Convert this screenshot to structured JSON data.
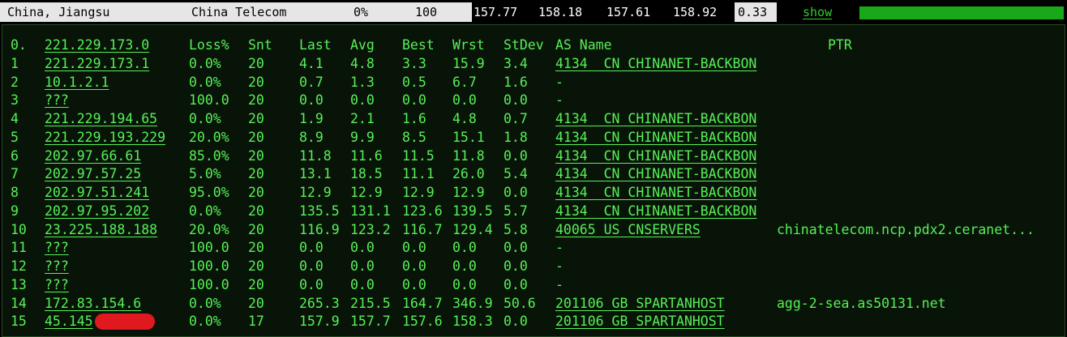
{
  "header": {
    "location": "China, Jiangsu",
    "isp": "China Telecom",
    "loss": "0%",
    "count": "100",
    "last": "157.77",
    "avg": "158.18",
    "best": "157.61",
    "worst": "158.92",
    "stdev": "0.33",
    "show_label": "show",
    "progress_fraction": 1.0,
    "progress_color": "#19a819"
  },
  "columns": {
    "idx": "0.",
    "host": "221.229.173.0",
    "loss": "Loss%",
    "snt": "Snt",
    "last": "Last",
    "avg": "Avg",
    "best": "Best",
    "wrst": "Wrst",
    "stdev": "StDev",
    "as": "AS Name",
    "ptr": "PTR"
  },
  "hops": [
    {
      "idx": "1",
      "host": "221.229.173.1",
      "loss": "0.0%",
      "snt": "20",
      "last": "4.1",
      "avg": "4.8",
      "best": "3.3",
      "wrst": "15.9",
      "stdev": "3.4",
      "as": "4134  CN CHINANET-BACKBON",
      "ptr": ""
    },
    {
      "idx": "2",
      "host": "10.1.2.1",
      "loss": "0.0%",
      "snt": "20",
      "last": "0.7",
      "avg": "1.3",
      "best": "0.5",
      "wrst": "6.7",
      "stdev": "1.6",
      "as": "-",
      "ptr": ""
    },
    {
      "idx": "3",
      "host": "???",
      "loss": "100.0",
      "snt": "20",
      "last": "0.0",
      "avg": "0.0",
      "best": "0.0",
      "wrst": "0.0",
      "stdev": "0.0",
      "as": "-",
      "ptr": ""
    },
    {
      "idx": "4",
      "host": "221.229.194.65",
      "loss": "0.0%",
      "snt": "20",
      "last": "1.9",
      "avg": "2.1",
      "best": "1.6",
      "wrst": "4.8",
      "stdev": "0.7",
      "as": "4134  CN CHINANET-BACKBON",
      "ptr": ""
    },
    {
      "idx": "5",
      "host": "221.229.193.229",
      "loss": "20.0%",
      "snt": "20",
      "last": "8.9",
      "avg": "9.9",
      "best": "8.5",
      "wrst": "15.1",
      "stdev": "1.8",
      "as": "4134  CN CHINANET-BACKBON",
      "ptr": ""
    },
    {
      "idx": "6",
      "host": "202.97.66.61",
      "loss": "85.0%",
      "snt": "20",
      "last": "11.8",
      "avg": "11.6",
      "best": "11.5",
      "wrst": "11.8",
      "stdev": "0.0",
      "as": "4134  CN CHINANET-BACKBON",
      "ptr": ""
    },
    {
      "idx": "7",
      "host": "202.97.57.25",
      "loss": "5.0%",
      "snt": "20",
      "last": "13.1",
      "avg": "18.5",
      "best": "11.1",
      "wrst": "26.0",
      "stdev": "5.4",
      "as": "4134  CN CHINANET-BACKBON",
      "ptr": ""
    },
    {
      "idx": "8",
      "host": "202.97.51.241",
      "loss": "95.0%",
      "snt": "20",
      "last": "12.9",
      "avg": "12.9",
      "best": "12.9",
      "wrst": "12.9",
      "stdev": "0.0",
      "as": "4134  CN CHINANET-BACKBON",
      "ptr": ""
    },
    {
      "idx": "9",
      "host": "202.97.95.202",
      "loss": "0.0%",
      "snt": "20",
      "last": "135.5",
      "avg": "131.1",
      "best": "123.6",
      "wrst": "139.5",
      "stdev": "5.7",
      "as": "4134  CN CHINANET-BACKBON",
      "ptr": ""
    },
    {
      "idx": "10",
      "host": "23.225.188.188",
      "loss": "20.0%",
      "snt": "20",
      "last": "116.9",
      "avg": "123.2",
      "best": "116.7",
      "wrst": "129.4",
      "stdev": "5.8",
      "as": "40065 US CNSERVERS",
      "ptr": "chinatelecom.ncp.pdx2.ceranet..."
    },
    {
      "idx": "11",
      "host": "???",
      "loss": "100.0",
      "snt": "20",
      "last": "0.0",
      "avg": "0.0",
      "best": "0.0",
      "wrst": "0.0",
      "stdev": "0.0",
      "as": "-",
      "ptr": ""
    },
    {
      "idx": "12",
      "host": "???",
      "loss": "100.0",
      "snt": "20",
      "last": "0.0",
      "avg": "0.0",
      "best": "0.0",
      "wrst": "0.0",
      "stdev": "0.0",
      "as": "-",
      "ptr": ""
    },
    {
      "idx": "13",
      "host": "???",
      "loss": "100.0",
      "snt": "20",
      "last": "0.0",
      "avg": "0.0",
      "best": "0.0",
      "wrst": "0.0",
      "stdev": "0.0",
      "as": "-",
      "ptr": ""
    },
    {
      "idx": "14",
      "host": "172.83.154.6",
      "loss": "0.0%",
      "snt": "20",
      "last": "265.3",
      "avg": "215.5",
      "best": "164.7",
      "wrst": "346.9",
      "stdev": "50.6",
      "as": "201106 GB SPARTANHOST",
      "ptr": "agg-2-sea.as50131.net"
    },
    {
      "idx": "15",
      "host": "45.145",
      "loss": "0.0%",
      "snt": "17",
      "last": "157.9",
      "avg": "157.7",
      "best": "157.6",
      "wrst": "158.3",
      "stdev": "0.0",
      "as": "201106 GB SPARTANHOST",
      "ptr": "",
      "redacted": true
    }
  ],
  "colors": {
    "text_green": "#57f057",
    "panel_bg": "#081408",
    "redaction": "#e0181f"
  }
}
